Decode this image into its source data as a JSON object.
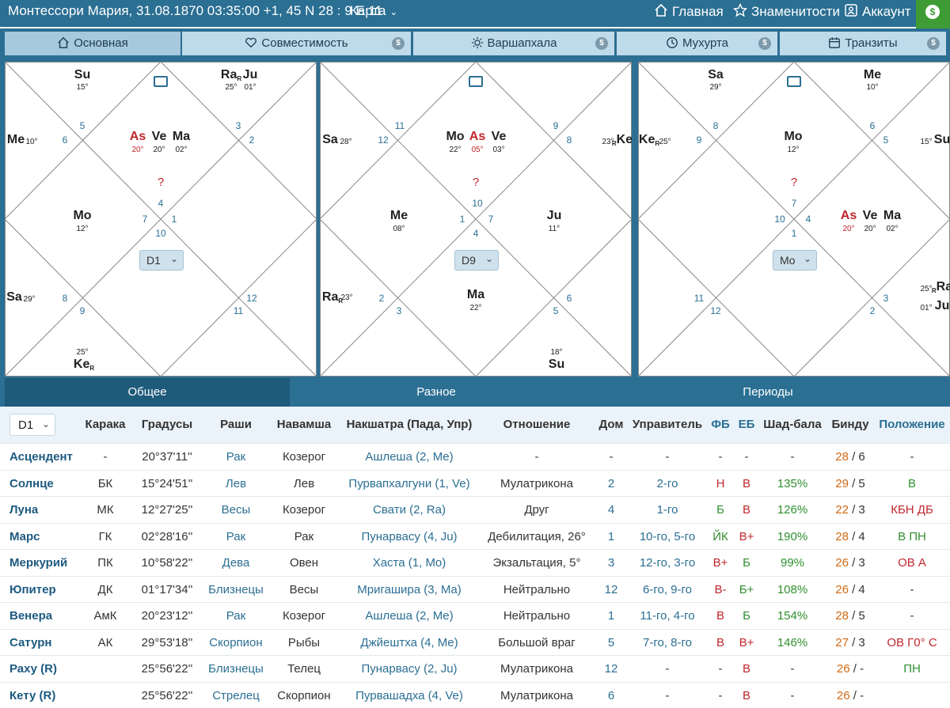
{
  "header": {
    "title": "Монтессори Мария, 31.08.1870 03:35:00 +1, 45 N 28 : 9 E 11",
    "map_label": "Карта",
    "nav": [
      {
        "label": "Главная",
        "icon": "home-icon"
      },
      {
        "label": "Знаменитости",
        "icon": "star-icon"
      },
      {
        "label": "Аккаунт",
        "icon": "account-icon"
      }
    ],
    "coin": "$"
  },
  "tabs": [
    {
      "label": "Основная",
      "icon": "home-icon",
      "active": true,
      "paid": false
    },
    {
      "label": "Совместимость",
      "icon": "heart-icon",
      "active": false,
      "paid": true
    },
    {
      "label": "Варшапхала",
      "icon": "sun-icon",
      "active": false,
      "paid": true
    },
    {
      "label": "Мухурта",
      "icon": "clock-icon",
      "active": false,
      "paid": true
    },
    {
      "label": "Транзиты",
      "icon": "calendar-icon",
      "active": false,
      "paid": true
    }
  ],
  "charts": [
    {
      "select": "D1",
      "question": "?",
      "houses": [
        "1",
        "2",
        "3",
        "4",
        "5",
        "6",
        "7",
        "8",
        "9",
        "10",
        "11",
        "12"
      ],
      "planets": [
        {
          "label": "Su",
          "deg": "15°"
        },
        {
          "label": "Ra",
          "retro": "R",
          "deg": "25°"
        },
        {
          "label": "Ju",
          "deg": "01°"
        },
        {
          "label": "Me",
          "deg": "10°"
        },
        {
          "label": "As",
          "deg": "20°",
          "red": true
        },
        {
          "label": "Ve",
          "deg": "20°"
        },
        {
          "label": "Ma",
          "deg": "02°"
        },
        {
          "label": "Mo",
          "deg": "12°"
        },
        {
          "label": "Sa",
          "deg": "29°"
        },
        {
          "label": "Ke",
          "retro": "R",
          "deg": "25°"
        }
      ]
    },
    {
      "select": "D9",
      "question": "?",
      "houses": [
        "1",
        "2",
        "3",
        "4",
        "5",
        "6",
        "7",
        "8",
        "9",
        "10",
        "11",
        "12"
      ],
      "planets": [
        {
          "label": "Mo",
          "deg": "22°"
        },
        {
          "label": "As",
          "deg": "05°",
          "red": true
        },
        {
          "label": "Ve",
          "deg": "03°"
        },
        {
          "label": "Sa",
          "deg": "28°"
        },
        {
          "label": "Ke",
          "retro": "R",
          "deg": "23°"
        },
        {
          "label": "Me",
          "deg": "08°"
        },
        {
          "label": "Ju",
          "deg": "11°"
        },
        {
          "label": "Ra",
          "retro": "R",
          "deg": "23°"
        },
        {
          "label": "Ma",
          "deg": "22°"
        },
        {
          "label": "Su",
          "deg": "18°"
        }
      ]
    },
    {
      "select": "Mo",
      "question": "?",
      "houses": [
        "1",
        "2",
        "3",
        "4",
        "5",
        "6",
        "7",
        "8",
        "9",
        "10",
        "11",
        "12"
      ],
      "planets": [
        {
          "label": "Sa",
          "deg": "29°"
        },
        {
          "label": "Me",
          "deg": "10°"
        },
        {
          "label": "Ke",
          "retro": "R",
          "deg": "25°"
        },
        {
          "label": "Mo",
          "deg": "12°"
        },
        {
          "label": "Su",
          "deg": "15°"
        },
        {
          "label": "As",
          "deg": "20°",
          "red": true
        },
        {
          "label": "Ve",
          "deg": "20°"
        },
        {
          "label": "Ma",
          "deg": "02°"
        },
        {
          "label": "Ra",
          "retro": "R",
          "deg": "25°"
        },
        {
          "label": "Ju",
          "deg": "01°"
        }
      ]
    }
  ],
  "bottom_tabs": [
    {
      "label": "Общее",
      "active": true
    },
    {
      "label": "Разное",
      "active": false
    },
    {
      "label": "Периоды",
      "active": false
    }
  ],
  "table": {
    "select": "D1",
    "columns": [
      "Карака",
      "Градусы",
      "Раши",
      "Навамша",
      "Накшатра (Пада, Упр)",
      "Отношение",
      "Дом",
      "Управитель",
      "ФБ",
      "ЕБ",
      "Шад-бала",
      "Бинду",
      "Положение"
    ],
    "rows": [
      {
        "name": "Асцендент",
        "karaka": "-",
        "deg": "20°37'11''",
        "rashi": "Рак",
        "navamsha": "Козерог",
        "nakshatra": "Ашлеша (2, Me)",
        "relation": "-",
        "house": "-",
        "ruler": "-",
        "fb": "-",
        "eb": "-",
        "shad": "-",
        "bindu1": "28",
        "bindu2": "6",
        "pos": "-"
      },
      {
        "name": "Солнце",
        "karaka": "БК",
        "deg": "15°24'51''",
        "rashi": "Лев",
        "navamsha": "Лев",
        "nakshatra": "Пурвапхалгуни (1, Ve)",
        "relation": "Мулатрикона",
        "house": "2",
        "ruler": "2-го",
        "fb": "Н",
        "eb": "В",
        "shad": "135%",
        "bindu1": "29",
        "bindu2": "5",
        "pos": "В"
      },
      {
        "name": "Луна",
        "karaka": "МК",
        "deg": "12°27'25''",
        "rashi": "Весы",
        "navamsha": "Козерог",
        "nakshatra": "Свати (2, Ra)",
        "relation": "Друг",
        "house": "4",
        "ruler": "1-го",
        "fb": "Б",
        "eb": "В",
        "shad": "126%",
        "bindu1": "22",
        "bindu2": "3",
        "pos": "КБН ДБ"
      },
      {
        "name": "Марс",
        "karaka": "ГК",
        "deg": "02°28'16''",
        "rashi": "Рак",
        "navamsha": "Рак",
        "nakshatra": "Пунарвасу (4, Ju)",
        "relation": "Дебилитация, 26°",
        "house": "1",
        "ruler": "10-го, 5-го",
        "fb": "ЙК",
        "eb": "В+",
        "shad": "190%",
        "bindu1": "28",
        "bindu2": "4",
        "pos": "В ПН"
      },
      {
        "name": "Меркурий",
        "karaka": "ПК",
        "deg": "10°58'22''",
        "rashi": "Дева",
        "navamsha": "Овен",
        "nakshatra": "Хаста (1, Mo)",
        "relation": "Экзальтация, 5°",
        "house": "3",
        "ruler": "12-го, 3-го",
        "fb": "В+",
        "eb": "Б",
        "shad": "99%",
        "bindu1": "26",
        "bindu2": "3",
        "pos": "ОВ А"
      },
      {
        "name": "Юпитер",
        "karaka": "ДК",
        "deg": "01°17'34''",
        "rashi": "Близнецы",
        "navamsha": "Весы",
        "nakshatra": "Мригашира (3, Ma)",
        "relation": "Нейтрально",
        "house": "12",
        "ruler": "6-го, 9-го",
        "fb": "В-",
        "eb": "Б+",
        "shad": "108%",
        "bindu1": "26",
        "bindu2": "4",
        "pos": "-"
      },
      {
        "name": "Венера",
        "karaka": "АмК",
        "deg": "20°23'12''",
        "rashi": "Рак",
        "navamsha": "Козерог",
        "nakshatra": "Ашлеша (2, Me)",
        "relation": "Нейтрально",
        "house": "1",
        "ruler": "11-го, 4-го",
        "fb": "В",
        "eb": "Б",
        "shad": "154%",
        "bindu1": "28",
        "bindu2": "5",
        "pos": "-"
      },
      {
        "name": "Сатурн",
        "karaka": "АК",
        "deg": "29°53'18''",
        "rashi": "Скорпион",
        "navamsha": "Рыбы",
        "nakshatra": "Джйештха (4, Me)",
        "relation": "Большой враг",
        "house": "5",
        "ruler": "7-го, 8-го",
        "fb": "В",
        "eb": "В+",
        "shad": "146%",
        "bindu1": "27",
        "bindu2": "3",
        "pos": "ОВ Г0° С"
      },
      {
        "name": "Раху (R)",
        "karaka": "",
        "deg": "25°56'22''",
        "rashi": "Близнецы",
        "navamsha": "Телец",
        "nakshatra": "Пунарвасу (2, Ju)",
        "relation": "Мулатрикона",
        "house": "12",
        "ruler": "-",
        "fb": "-",
        "eb": "В",
        "shad": "-",
        "bindu1": "26",
        "bindu2": "-",
        "pos": "ПН"
      },
      {
        "name": "Кету (R)",
        "karaka": "",
        "deg": "25°56'22''",
        "rashi": "Стрелец",
        "navamsha": "Скорпион",
        "nakshatra": "Пурвашадха (4, Ve)",
        "relation": "Мулатрикона",
        "house": "6",
        "ruler": "-",
        "fb": "-",
        "eb": "В",
        "shad": "-",
        "bindu1": "26",
        "bindu2": "-",
        "pos": ""
      }
    ]
  }
}
